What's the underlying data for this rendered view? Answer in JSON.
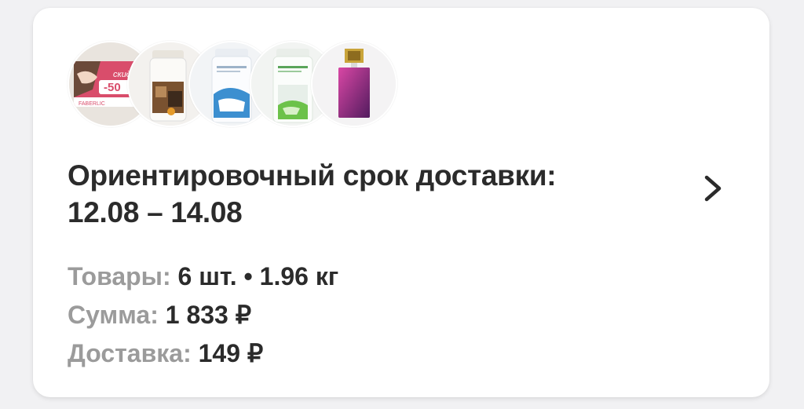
{
  "thumbnails": [
    {
      "name": "promo-faberlic-discount",
      "promo_text_top": "скидки",
      "promo_text_mid": "-50",
      "promo_brand": "FABERLIC"
    },
    {
      "name": "product-kitchen-cleaner"
    },
    {
      "name": "product-laundry-blue"
    },
    {
      "name": "product-cleaner-green"
    },
    {
      "name": "product-perfume"
    }
  ],
  "delivery": {
    "title_line1": "Ориентировочный срок доставки:",
    "title_line2": "12.08 – 14.08"
  },
  "summary": {
    "items_label": "Товары:",
    "items_value": "6 шт. • 1.96 кг",
    "sum_label": "Сумма:",
    "sum_value": "1 833 ₽",
    "delivery_label": "Доставка:",
    "delivery_value": "149 ₽"
  },
  "icons": {
    "chevron": "chevron-right-icon"
  }
}
